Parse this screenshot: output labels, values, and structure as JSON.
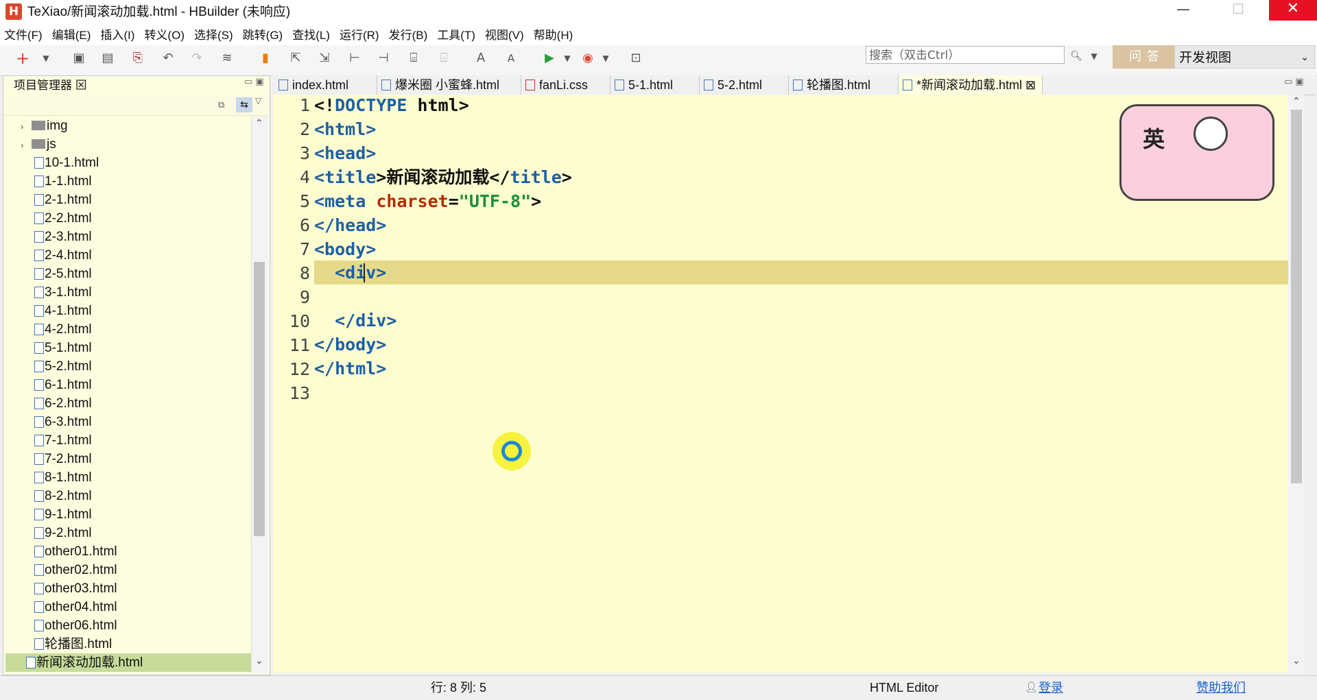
{
  "window": {
    "title": "TeXiao/新闻滚动加载.html  -  HBuilder  (未响应)",
    "logo": "H",
    "minimize": "—",
    "maximize": "☐",
    "close": "✕"
  },
  "menu": [
    "文件(F)",
    "编辑(E)",
    "插入(I)",
    "转义(O)",
    "选择(S)",
    "跳转(G)",
    "查找(L)",
    "运行(R)",
    "发行(B)",
    "工具(T)",
    "视图(V)",
    "帮助(H)"
  ],
  "toolbar": {
    "search_placeholder": "搜索（双击Ctrl）",
    "qa_label": "问答",
    "view_select": "开发视图"
  },
  "project_panel": {
    "title": "项目管理器 ⊠",
    "folders": [
      "img",
      "js"
    ],
    "files": [
      "10-1.html",
      "1-1.html",
      "2-1.html",
      "2-2.html",
      "2-3.html",
      "2-4.html",
      "2-5.html",
      "3-1.html",
      "4-1.html",
      "4-2.html",
      "5-1.html",
      "5-2.html",
      "6-1.html",
      "6-2.html",
      "6-3.html",
      "7-1.html",
      "7-2.html",
      "8-1.html",
      "8-2.html",
      "9-1.html",
      "9-2.html",
      "other01.html",
      "other02.html",
      "other03.html",
      "other04.html",
      "other06.html",
      "轮播图.html",
      "新闻滚动加载.html"
    ]
  },
  "editor_tabs": [
    "index.html",
    "爆米圈 小蜜蜂.html",
    "fanLi.css",
    "5-1.html",
    "5-2.html",
    "轮播图.html",
    "*新闻滚动加载.html ⊠"
  ],
  "code": {
    "line_numbers": [
      "1",
      "2",
      "3",
      "4",
      "5",
      "6",
      "7",
      "8",
      "9",
      "10",
      "11",
      "12",
      "13"
    ],
    "l1_a": "<!",
    "l1_b": "DOCTYPE",
    "l1_c": " html>",
    "l2": "<html>",
    "l3": "<head>",
    "l4_a": "<",
    "l4_b": "title",
    "l4_c": ">新闻滚动加载</",
    "l4_d": "title",
    "l4_e": ">",
    "l5_a": "<",
    "l5_b": "meta",
    "l5_c": " ",
    "l5_d": "charset",
    "l5_e": "=",
    "l5_f": "\"UTF-8\"",
    "l5_g": ">",
    "l6": "</head>",
    "l7": "<body>",
    "l8": "  <div>",
    "l9": "",
    "l10": "  </div>",
    "l11": "</body>",
    "l12": "</html>",
    "l13": ""
  },
  "sticker_text": "英",
  "status": {
    "position": "行: 8 列: 5",
    "mode": "HTML Editor",
    "login": "登录",
    "donate": "赞助我们"
  }
}
